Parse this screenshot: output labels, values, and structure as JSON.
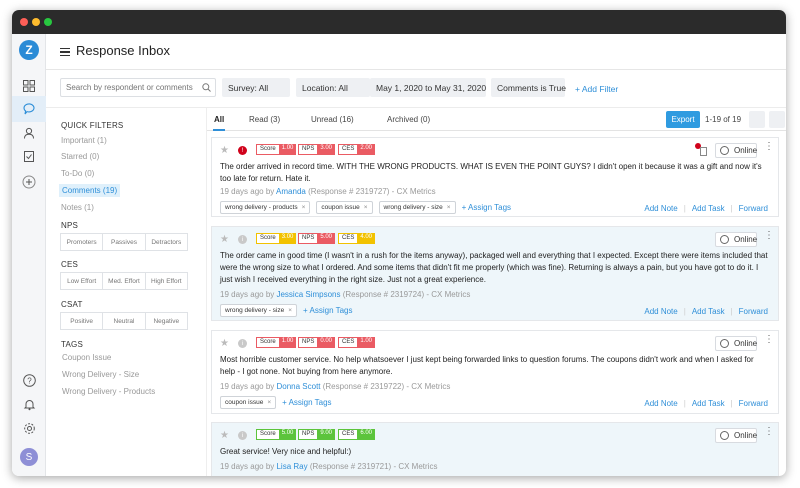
{
  "page": {
    "title": "Response Inbox"
  },
  "colors": {
    "accent": "#2f8fd8",
    "red": "#ea5b63",
    "yellow": "#f2c200",
    "green": "#5cc43c",
    "export": "#2f9be0"
  },
  "rail": {
    "logo": "Z",
    "avatar": "S",
    "icons": [
      "apps-icon",
      "chat-icon",
      "user-icon",
      "clipboard-check-icon",
      "add-icon",
      "help-icon",
      "bell-icon",
      "gear-icon"
    ]
  },
  "filters": {
    "search_placeholder": "Search by respondent or comments",
    "survey": "Survey: All",
    "location": "Location: All",
    "date": "May 1, 2020 to May 31, 2020",
    "comments": "Comments is True",
    "add_filter": "+ Add Filter"
  },
  "left": {
    "quick_filters_title": "QUICK FILTERS",
    "quick_filters": [
      "Important (1)",
      "Starred (0)",
      "To-Do (0)",
      "Comments (19)",
      "Notes (1)"
    ],
    "nps_title": "NPS",
    "nps": [
      "Promoters",
      "Passives",
      "Detractors"
    ],
    "ces_title": "CES",
    "ces": [
      "Low Effort",
      "Med. Effort",
      "High Effort"
    ],
    "csat_title": "CSAT",
    "csat": [
      "Positive",
      "Neutral",
      "Negative"
    ],
    "tags_title": "TAGS",
    "tags": [
      "Coupon Issue",
      "Wrong Delivery - Size",
      "Wrong Delivery - Products"
    ]
  },
  "tabs": [
    "All",
    "Read (3)",
    "Unread (16)",
    "Archived (0)"
  ],
  "toolbar": {
    "export": "Export",
    "pagination": "1-19 of 19"
  },
  "cards": [
    {
      "score": "1.00",
      "nps": "3.00",
      "ces": "2.00",
      "score_label": "Score",
      "nps_label": "NPS",
      "ces_label": "CES",
      "text": "The order arrived in record time. WITH THE WRONG PRODUCTS. WHAT IS EVEN THE POINT GUYS? I didn't open it because it was a gift and now it's too late for return. Hate it.",
      "meta_prefix": "19 days ago by ",
      "author": "Amanda",
      "meta_suffix": " (Response # 2319727) - CX Metrics",
      "tags": [
        "wrong delivery - products",
        "coupon issue",
        "wrong delivery - size"
      ],
      "assign": "+ Assign Tags",
      "status": "Online",
      "actions": [
        "Add Note",
        "Add Task",
        "Forward"
      ]
    },
    {
      "score": "3.00",
      "nps": "5.00",
      "ces": "4.00",
      "score_label": "Score",
      "nps_label": "NPS",
      "ces_label": "CES",
      "text": "The order came in good time (I wasn't in a rush for the items anyway), packaged well and everything that I expected. Except there were items included that were the wrong size to what I ordered. And some items that didn't fit me properly (which was fine). Returning is always a pain, but you have got to do it. I just wish I received everything in the right size. Just not a great experience.",
      "meta_prefix": "19 days ago by ",
      "author": "Jessica Simpsons",
      "meta_suffix": " (Response # 2319724) - CX Metrics",
      "tags": [
        "wrong delivery - size"
      ],
      "assign": "+ Assign Tags",
      "status": "Online",
      "actions": [
        "Add Note",
        "Add Task",
        "Forward"
      ]
    },
    {
      "score": "1.00",
      "nps": "0.00",
      "ces": "1.00",
      "score_label": "Score",
      "nps_label": "NPS",
      "ces_label": "CES",
      "text": "Most horrible customer service. No help whatsoever I just kept being forwarded links to question forums. The coupons didn't work and when I asked for help - I got none. Not buying from here anymore.",
      "meta_prefix": "19 days ago by ",
      "author": "Donna Scott",
      "meta_suffix": " (Response # 2319722) - CX Metrics",
      "tags": [
        "coupon issue"
      ],
      "assign": "+ Assign Tags",
      "status": "Online",
      "actions": [
        "Add Note",
        "Add Task",
        "Forward"
      ]
    },
    {
      "score": "5.00",
      "nps": "9.00",
      "ces": "6.00",
      "score_label": "Score",
      "nps_label": "NPS",
      "ces_label": "CES",
      "text": "Great service! Very nice and helpful:)",
      "meta_prefix": "19 days ago by ",
      "author": "Lisa Ray",
      "meta_suffix": " (Response # 2319721) - CX Metrics",
      "tags": [],
      "assign": "",
      "status": "Online",
      "actions": []
    }
  ]
}
